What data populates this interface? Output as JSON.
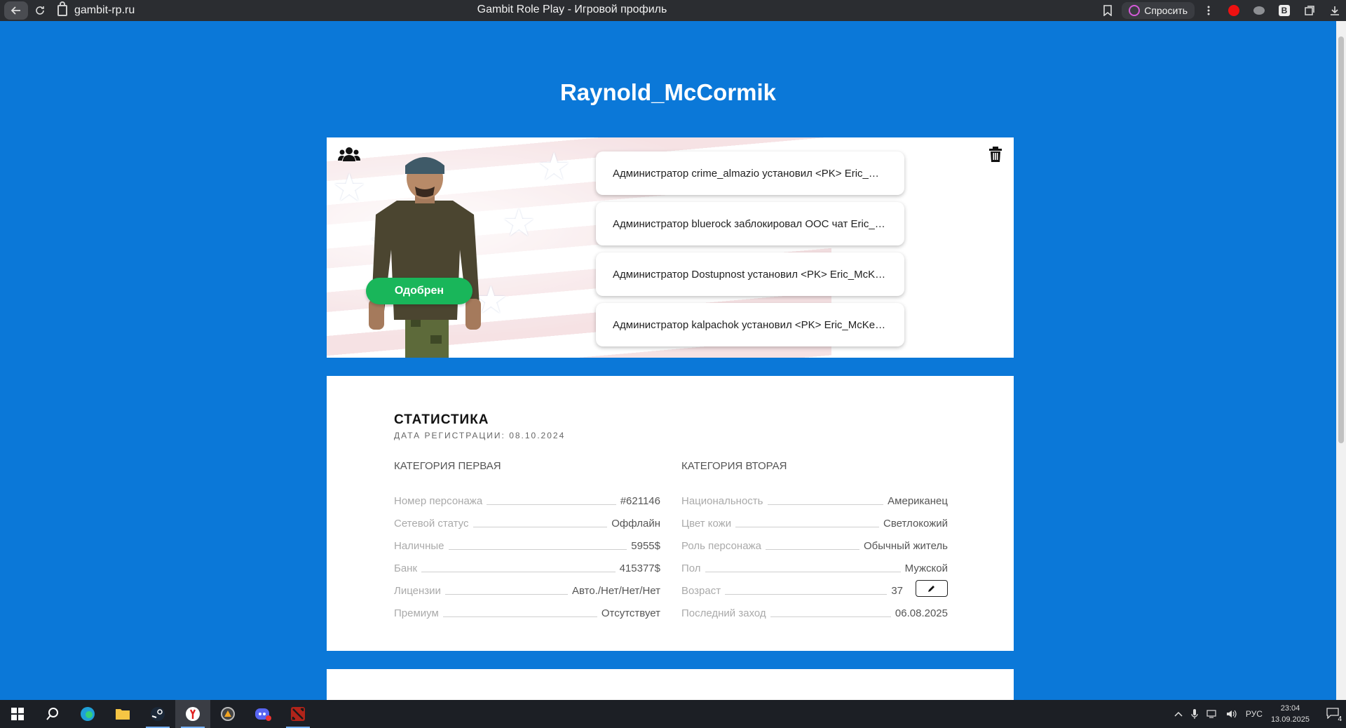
{
  "browser": {
    "url": "gambit-rp.ru",
    "tab_title": "Gambit Role Play - Игровой профиль",
    "ask_label": "Спросить"
  },
  "profile": {
    "username": "Raynold_McCormik",
    "status": "Одобрен"
  },
  "logs": [
    "Администратор crime_almazio установил <PK> Eric_McKenzie",
    "Администратор bluerock заблокировал OOC чат Eric_McKenzie",
    "Администратор Dostupnost установил <PK> Eric_McKenzie",
    "Администратор kalpachok установил <PK> Eric_McKenzie"
  ],
  "stats": {
    "title": "СТАТИСТИКА",
    "registered": "ДАТА РЕГИСТРАЦИИ: 08.10.2024",
    "cat1_title": "КАТЕГОРИЯ ПЕРВАЯ",
    "cat2_title": "КАТЕГОРИЯ ВТОРАЯ",
    "cat1": [
      {
        "label": "Номер персонажа",
        "value": "#621146"
      },
      {
        "label": "Сетевой статус",
        "value": "Оффлайн"
      },
      {
        "label": "Наличные",
        "value": "5955$"
      },
      {
        "label": "Банк",
        "value": "415377$"
      },
      {
        "label": "Лицензии",
        "value": "Авто./Нет/Нет/Нет"
      },
      {
        "label": "Премиум",
        "value": "Отсутствует"
      }
    ],
    "cat2": [
      {
        "label": "Национальность",
        "value": "Американец"
      },
      {
        "label": "Цвет кожи",
        "value": "Светлокожий"
      },
      {
        "label": "Роль персонажа",
        "value": "Обычный житель"
      },
      {
        "label": "Пол",
        "value": "Мужской"
      },
      {
        "label": "Возраст",
        "value": "37"
      },
      {
        "label": "Последний заход",
        "value": "06.08.2025"
      }
    ]
  },
  "taskbar": {
    "lang": "РУС",
    "time": "23:04",
    "date": "13.09.2025",
    "notif_count": "4"
  },
  "colors": {
    "page_bg": "#0b78d8",
    "status_green": "#19b65a"
  }
}
